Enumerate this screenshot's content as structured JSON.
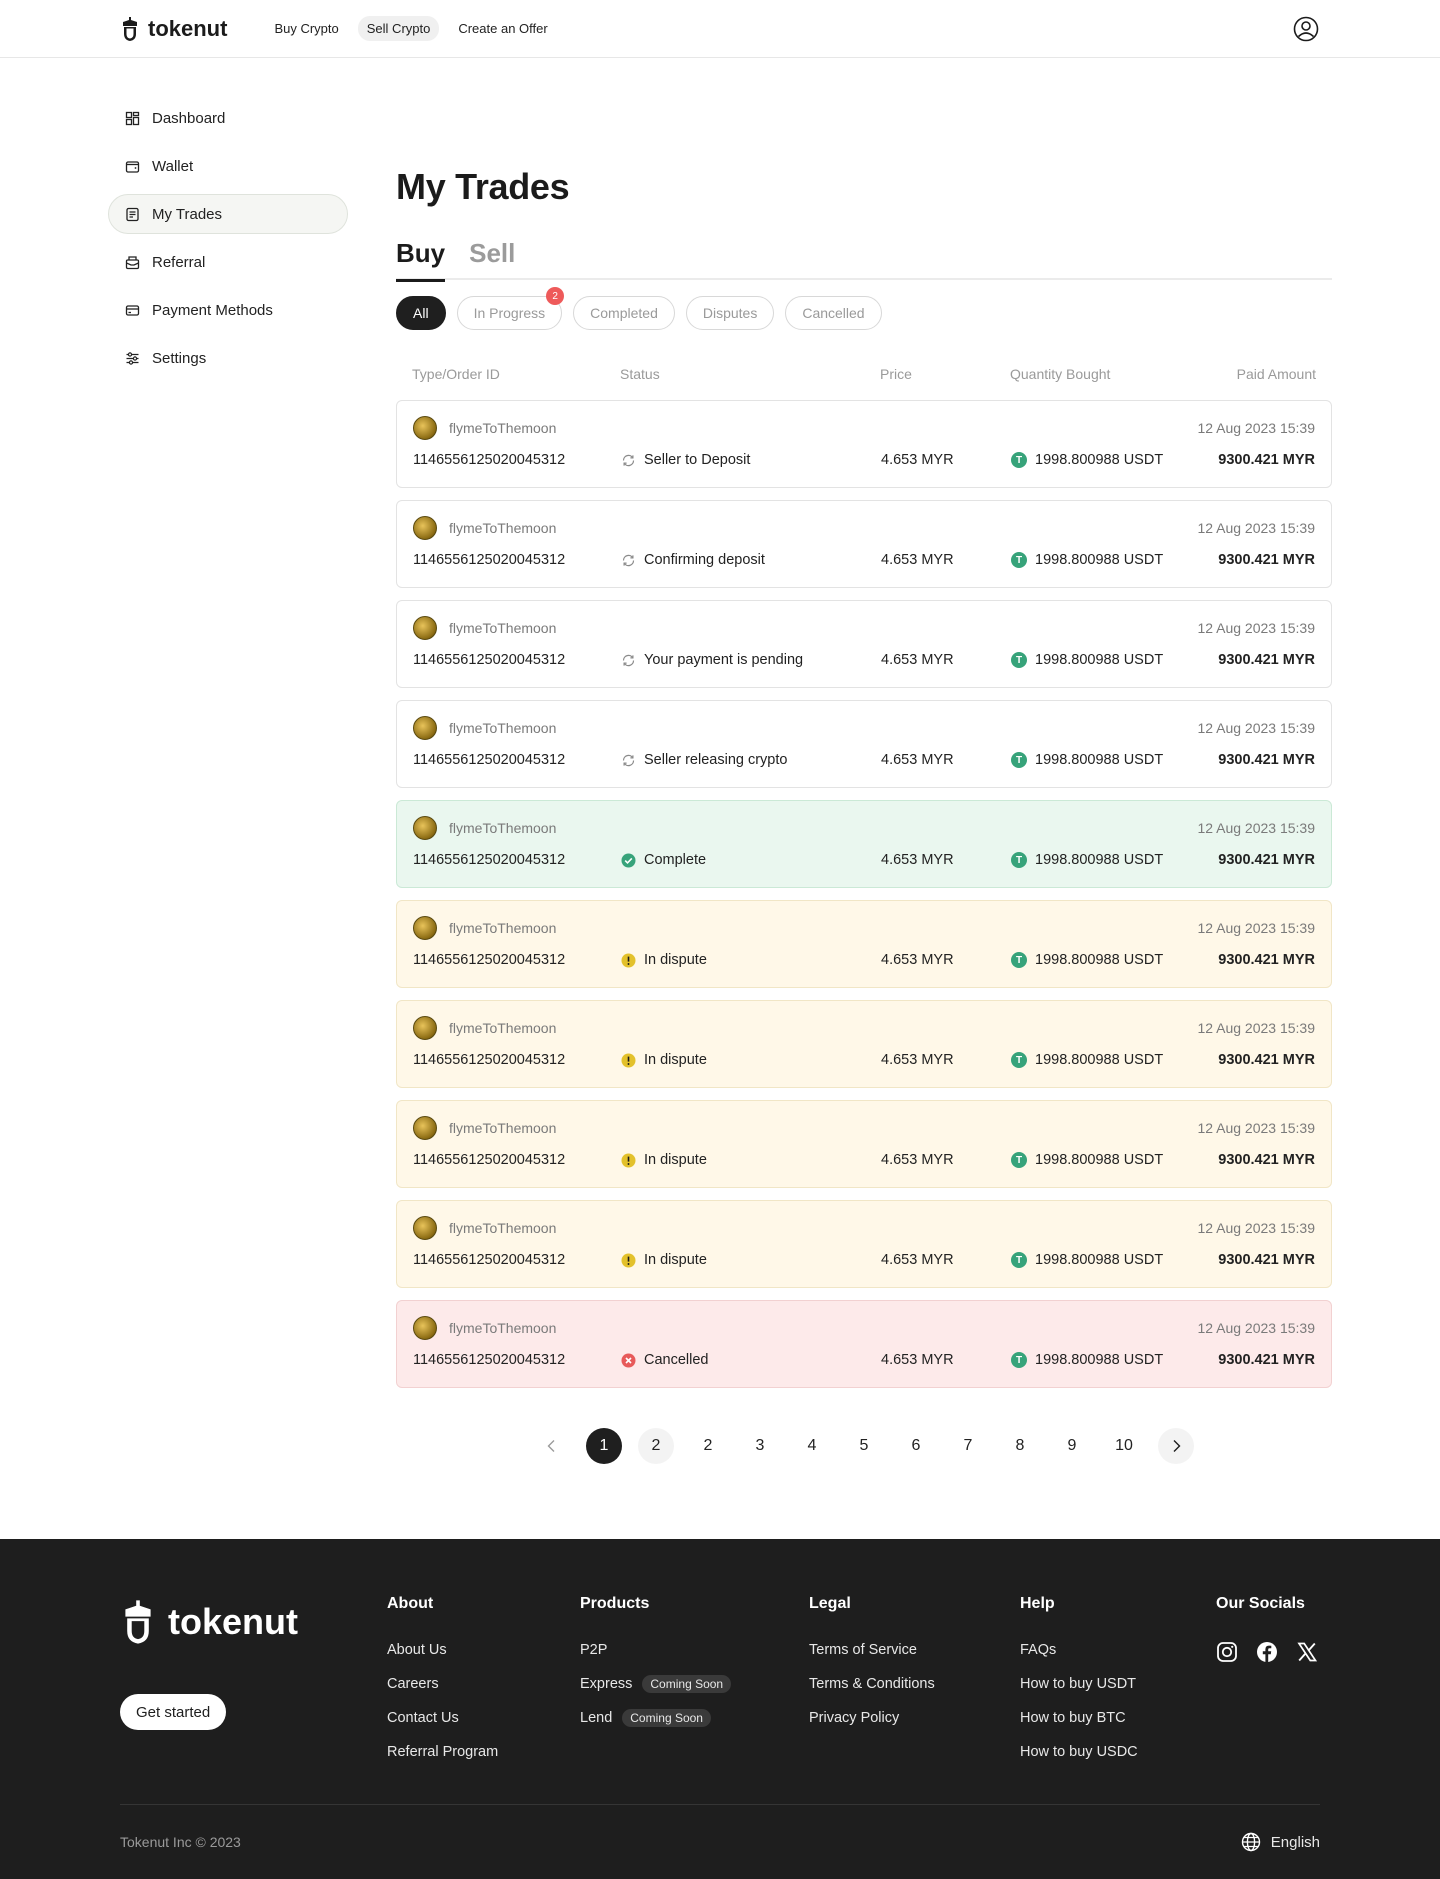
{
  "header": {
    "brand": "tokenut",
    "nav": [
      "Buy Crypto",
      "Sell Crypto",
      "Create an Offer"
    ],
    "active_nav": "Sell Crypto"
  },
  "sidebar": {
    "items": [
      {
        "label": "Dashboard",
        "icon": "dashboard-icon"
      },
      {
        "label": "Wallet",
        "icon": "wallet-icon"
      },
      {
        "label": "My Trades",
        "icon": "trades-icon",
        "active": true
      },
      {
        "label": "Referral",
        "icon": "referral-icon"
      },
      {
        "label": "Payment Methods",
        "icon": "card-icon"
      },
      {
        "label": "Settings",
        "icon": "sliders-icon"
      }
    ]
  },
  "main": {
    "title": "My Trades",
    "tabs": [
      "Buy",
      "Sell"
    ],
    "filters": [
      "All",
      "In Progress",
      "Completed",
      "Disputes",
      "Cancelled"
    ],
    "in_progress_count": "2",
    "columns": [
      "Type/Order ID",
      "Status",
      "Price",
      "Quantity Bought",
      "Paid Amount"
    ],
    "trades": [
      {
        "user": "flymeToThemoon",
        "date": "12 Aug 2023 15:39",
        "order_id": "1146556125020045312",
        "status": "Seller to Deposit",
        "kind": "progress",
        "price": "4.653 MYR",
        "quantity": "1998.800988 USDT",
        "paid": "9300.421 MYR"
      },
      {
        "user": "flymeToThemoon",
        "date": "12 Aug 2023 15:39",
        "order_id": "1146556125020045312",
        "status": "Confirming deposit",
        "kind": "progress",
        "price": "4.653 MYR",
        "quantity": "1998.800988 USDT",
        "paid": "9300.421 MYR"
      },
      {
        "user": "flymeToThemoon",
        "date": "12 Aug 2023 15:39",
        "order_id": "1146556125020045312",
        "status": "Your payment is pending",
        "kind": "progress",
        "price": "4.653 MYR",
        "quantity": "1998.800988 USDT",
        "paid": "9300.421 MYR"
      },
      {
        "user": "flymeToThemoon",
        "date": "12 Aug 2023 15:39",
        "order_id": "1146556125020045312",
        "status": "Seller releasing crypto",
        "kind": "progress",
        "price": "4.653 MYR",
        "quantity": "1998.800988 USDT",
        "paid": "9300.421 MYR"
      },
      {
        "user": "flymeToThemoon",
        "date": "12 Aug 2023 15:39",
        "order_id": "1146556125020045312",
        "status": "Complete",
        "kind": "complete",
        "price": "4.653 MYR",
        "quantity": "1998.800988 USDT",
        "paid": "9300.421 MYR"
      },
      {
        "user": "flymeToThemoon",
        "date": "12 Aug 2023 15:39",
        "order_id": "1146556125020045312",
        "status": "In dispute",
        "kind": "dispute",
        "price": "4.653 MYR",
        "quantity": "1998.800988 USDT",
        "paid": "9300.421 MYR"
      },
      {
        "user": "flymeToThemoon",
        "date": "12 Aug 2023 15:39",
        "order_id": "1146556125020045312",
        "status": "In dispute",
        "kind": "dispute",
        "price": "4.653 MYR",
        "quantity": "1998.800988 USDT",
        "paid": "9300.421 MYR"
      },
      {
        "user": "flymeToThemoon",
        "date": "12 Aug 2023 15:39",
        "order_id": "1146556125020045312",
        "status": "In dispute",
        "kind": "dispute",
        "price": "4.653 MYR",
        "quantity": "1998.800988 USDT",
        "paid": "9300.421 MYR"
      },
      {
        "user": "flymeToThemoon",
        "date": "12 Aug 2023 15:39",
        "order_id": "1146556125020045312",
        "status": "In dispute",
        "kind": "dispute",
        "price": "4.653 MYR",
        "quantity": "1998.800988 USDT",
        "paid": "9300.421 MYR"
      },
      {
        "user": "flymeToThemoon",
        "date": "12 Aug 2023 15:39",
        "order_id": "1146556125020045312",
        "status": "Cancelled",
        "kind": "cancelled",
        "price": "4.653 MYR",
        "quantity": "1998.800988 USDT",
        "paid": "9300.421 MYR"
      }
    ],
    "pagination": {
      "pages": [
        "1",
        "2",
        "2",
        "3",
        "4",
        "5",
        "6",
        "7",
        "8",
        "9",
        "10"
      ],
      "current": "1"
    }
  },
  "footer": {
    "brand": "tokenut",
    "cta": "Get started",
    "columns": [
      {
        "title": "About",
        "links": [
          {
            "label": "About Us"
          },
          {
            "label": "Careers"
          },
          {
            "label": "Contact Us"
          },
          {
            "label": "Referral Program"
          }
        ]
      },
      {
        "title": "Products",
        "links": [
          {
            "label": "P2P"
          },
          {
            "label": "Express",
            "badge": "Coming Soon"
          },
          {
            "label": "Lend",
            "badge": "Coming Soon"
          }
        ]
      },
      {
        "title": "Legal",
        "links": [
          {
            "label": "Terms of Service"
          },
          {
            "label": "Terms & Conditions"
          },
          {
            "label": "Privacy Policy"
          }
        ]
      },
      {
        "title": "Help",
        "links": [
          {
            "label": "FAQs"
          },
          {
            "label": "How to buy USDT"
          },
          {
            "label": "How to buy BTC"
          },
          {
            "label": "How to buy USDC"
          }
        ]
      }
    ],
    "socials_title": "Our Socials",
    "socials": [
      "instagram-icon",
      "facebook-icon",
      "x-icon"
    ],
    "copyright": "Tokenut Inc © 2023",
    "language": "English"
  },
  "colors": {
    "complete_bg": "#eaf7ef",
    "dispute_bg": "#fff8e8",
    "cancelled_bg": "#fdeaea",
    "accent_dark": "#1f1f1f",
    "badge_red": "#ee5a5a",
    "usdt_green": "#37a37a"
  }
}
